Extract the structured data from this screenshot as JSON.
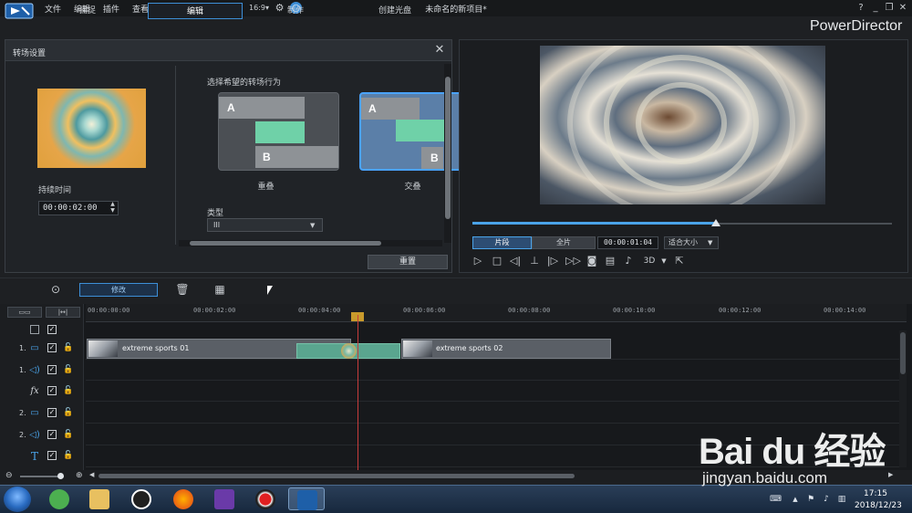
{
  "menu": {
    "items": [
      "文件",
      "编辑",
      "插件",
      "查看",
      "播放"
    ],
    "doc_title": "未命名的新项目*",
    "help": "?",
    "window_controls": [
      "minimize-icon",
      "restore-icon",
      "close-icon"
    ]
  },
  "modes": {
    "tabs": [
      {
        "label": "捕捉",
        "active": false
      },
      {
        "label": "编辑",
        "active": true
      },
      {
        "label": "制作",
        "active": false
      },
      {
        "label": "创建光盘",
        "active": false
      }
    ],
    "brand": "PowerDirector"
  },
  "dialog": {
    "title": "转场设置",
    "duration_label": "持续时间",
    "duration_value": "00:00:02:00",
    "behavior_label": "选择希望的转场行为",
    "options": [
      {
        "label": "重叠",
        "selected": false,
        "a": "A",
        "b": "B"
      },
      {
        "label": "交叠",
        "selected": true,
        "a": "A",
        "b": "B"
      }
    ],
    "type_label": "类型",
    "type_value": "III",
    "reset_label": "重置"
  },
  "preview": {
    "progress": 0.58,
    "clip_tab": "片段",
    "full_tab": "全片",
    "timecode": "00:00:01:04",
    "fit_label": "适合大小",
    "mode_3d": "3D",
    "controls": [
      "play-icon",
      "stop-icon",
      "prev-frame-icon",
      "trim-icon",
      "next-frame-icon",
      "fast-forward-icon",
      "snapshot-icon",
      "subtitle-icon",
      "volume-icon",
      "3d-icon",
      "undock-icon"
    ]
  },
  "edit_toolbar": {
    "modify_label": "修改"
  },
  "timeline": {
    "ruler": [
      "00:00:00:00",
      "00:00:02:00",
      "00:00:04:00",
      "00:00:06:00",
      "00:00:08:00",
      "00:00:10:00",
      "00:00:12:00",
      "00:00:14:00"
    ],
    "tracks": [
      {
        "num": "1.",
        "icon": "video-track-icon"
      },
      {
        "num": "1.",
        "icon": "audio-track-icon"
      },
      {
        "num": "",
        "icon": "fx-track-icon",
        "glyph": "fx"
      },
      {
        "num": "2.",
        "icon": "video-track-icon"
      },
      {
        "num": "2.",
        "icon": "audio-track-icon"
      },
      {
        "num": "",
        "icon": "title-track-icon",
        "glyph": "T"
      }
    ],
    "clips": [
      {
        "name": "extreme sports 01"
      },
      {
        "name": "extreme sports 02"
      }
    ]
  },
  "taskbar": {
    "time": "17:15",
    "date": "2018/12/23"
  },
  "watermark": {
    "logo": "Bai du 经验",
    "url": "jingyan.baidu.com"
  }
}
